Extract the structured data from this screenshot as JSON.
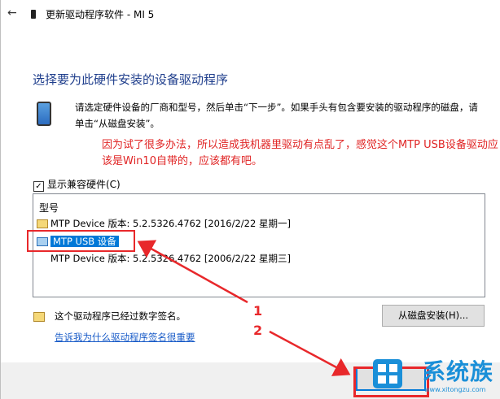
{
  "window": {
    "title": "更新驱动程序软件 - MI 5"
  },
  "heading": "选择要为此硬件安装的设备驱动程序",
  "description": "请选定硬件设备的厂商和型号，然后单击“下一步”。如果手头有包含要安装的驱动程序的磁盘，请单击“从磁盘安装”。",
  "annotation_note": "因为试了很多办法，所以造成我机器里驱动有点乱了，感觉这个MTP USB设备驱动应该是Win10自带的，应该都有吧。",
  "compat": {
    "checked": true,
    "label": "显示兼容硬件(C)"
  },
  "model_list": {
    "header": "型号",
    "items": [
      {
        "label": "MTP Device 版本: 5.2.5326.4762 [2016/2/22 星期一]",
        "icon": "certificate-icon",
        "selected": false
      },
      {
        "label": "MTP USB 设备",
        "icon": "device-icon",
        "selected": true
      },
      {
        "label": "MTP Device 版本: 5.2.5326.4762 [2006/2/22 星期三]",
        "icon": "",
        "selected": false
      }
    ]
  },
  "signed_text": "这个驱动程序已经过数字签名。",
  "signing_link": "告诉我为什么驱动程序签名很重要",
  "have_disk_button": "从磁盘安装(H)...",
  "callouts": [
    "1",
    "2"
  ],
  "colors": {
    "accent": "#0078d7",
    "heading": "#1f3e8c",
    "annotation": "#e02424",
    "highlight_box": "#e8282b"
  },
  "watermark": {
    "text": "系统族",
    "url": "www.xitongzu.com"
  }
}
